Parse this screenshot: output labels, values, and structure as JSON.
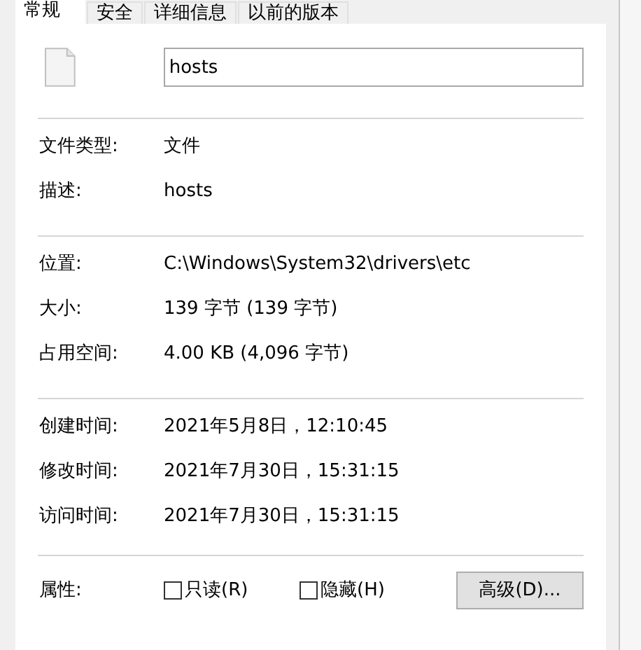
{
  "tabs": [
    {
      "label": "常规",
      "selected": true
    },
    {
      "label": "安全",
      "selected": false
    },
    {
      "label": "详细信息",
      "selected": false
    },
    {
      "label": "以前的版本",
      "selected": false
    }
  ],
  "file_name": "hosts",
  "sections": [
    [
      {
        "label": "文件类型:",
        "value": "文件"
      },
      {
        "label": "描述:",
        "value": "hosts"
      }
    ],
    [
      {
        "label": "位置:",
        "value": "C:\\Windows\\System32\\drivers\\etc"
      },
      {
        "label": "大小:",
        "value": "139 字节 (139 字节)"
      },
      {
        "label": "占用空间:",
        "value": "4.00 KB (4,096 字节)"
      }
    ],
    [
      {
        "label": "创建时间:",
        "value": "2021年5月8日，12:10:45"
      },
      {
        "label": "修改时间:",
        "value": "2021年7月30日，15:31:15"
      },
      {
        "label": "访问时间:",
        "value": "2021年7月30日，15:31:15"
      }
    ]
  ],
  "attributes": {
    "label": "属性:",
    "options": [
      {
        "label": "只读(R)",
        "checked": false
      },
      {
        "label": "隐藏(H)",
        "checked": false
      }
    ],
    "button": "高级(D)..."
  }
}
